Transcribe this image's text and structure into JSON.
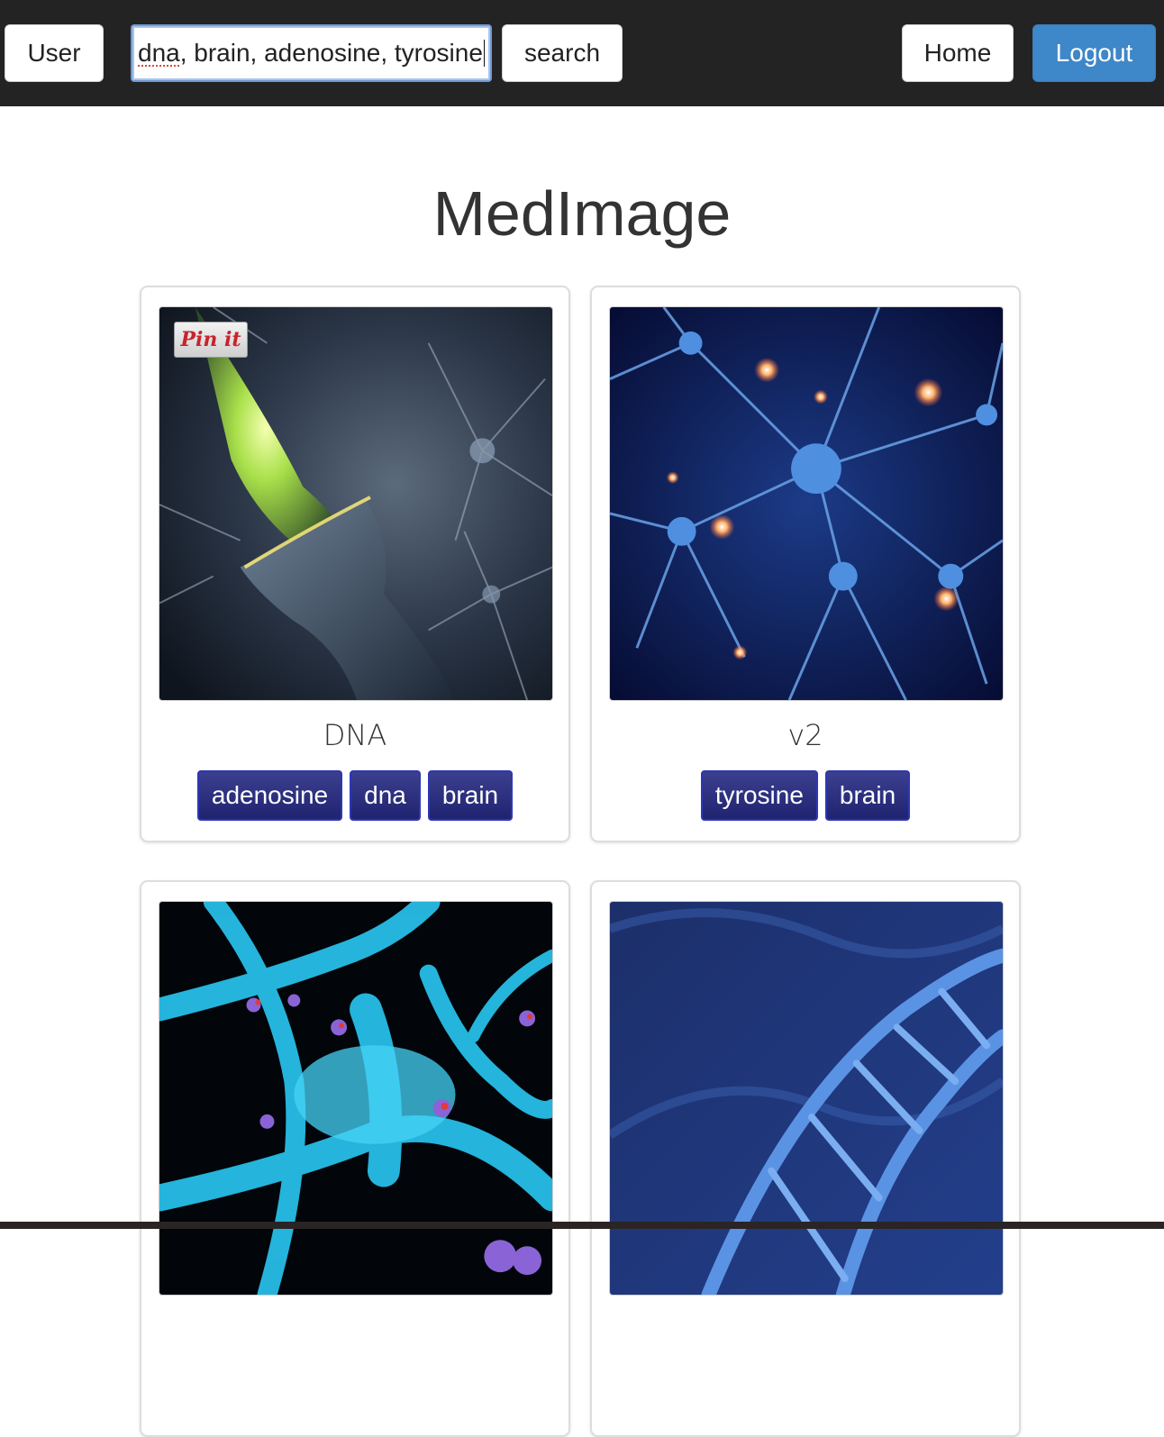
{
  "navbar": {
    "user_label": "User",
    "search": {
      "value_misspelled": "dna",
      "value_rest": ", brain, adenosine, tyrosine"
    },
    "search_label": "search",
    "home_label": "Home",
    "logout_label": "Logout",
    "logout_color": "#3e87c8"
  },
  "page": {
    "title": "MedImage"
  },
  "cards": [
    {
      "title": "DNA",
      "pin_label": "Pin it",
      "image": "synapse-glow-image",
      "tags": [
        "adenosine",
        "dna",
        "brain"
      ]
    },
    {
      "title": "v2",
      "image": "neuron-network-image",
      "tags": [
        "tyrosine",
        "brain"
      ]
    },
    {
      "title": "",
      "image": "cyan-synapse-image",
      "tags": []
    },
    {
      "title": "",
      "image": "dna-helix-image",
      "tags": []
    }
  ],
  "colors": {
    "tag_bg": "#262a7a",
    "tag_border": "#2d37b5",
    "navbar_bg": "#232323"
  }
}
